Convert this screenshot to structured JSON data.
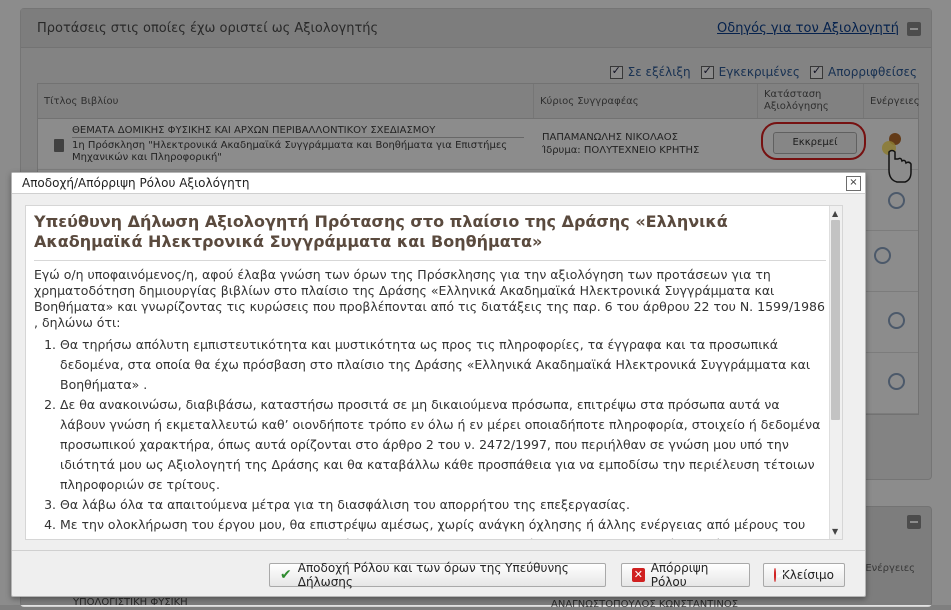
{
  "background": {
    "panel_title": "Προτάσεις στις οποίες έχω οριστεί ως Αξιολογητής",
    "guide_link": "Οδηγός για τον Αξιολογητή",
    "filters": [
      "Σε εξέλιξη",
      "Εγκεκριμένες",
      "Απορριφθείσες"
    ],
    "columns": {
      "title": "Τίτλος Βιβλίου",
      "author": "Κύριος Συγγραφέας",
      "status": "Κατάσταση Αξιολόγησης",
      "actions": "Ενέργειες"
    },
    "row": {
      "book_title": "ΘΕΜΑΤΑ ΔΟΜΙΚΗΣ ΦΥΣΙΚΗΣ ΚΑΙ ΑΡΧΩΝ ΠΕΡΙΒΑΛΛΟΝΤΙΚΟΥ ΣΧΕΔΙΑΣΜΟΥ",
      "call": "1η Πρόσκληση \"Ηλεκτρονικά Ακαδημαϊκά Συγγράμματα και Βοηθήματα για Επιστήμες Μηχανικών και Πληροφορική\"",
      "author": "ΠΑΠΑΜΑΝΩΛΗΣ ΝΙΚΟΛΑΟΣ",
      "institution": "Ίδρυμα: ΠΟΛΥΤΕΧΝΕΙΟ ΚΡΗΤΗΣ",
      "status": "Εκκρεμεί"
    },
    "panel2": {
      "col_actions": "Ενέργειες",
      "row_title": "ΥΠΟΛΟΓΙΣΤΙΚΗ ΦΥΣΙΚΗ",
      "row_author": "ΑΝΑΓΝΩΣΤΟΠΟΥΛΟΣ ΚΩΝΣΤΑΝΤΙΝΟΣ"
    }
  },
  "dialog": {
    "title": "Αποδοχή/Απόρριψη Ρόλου Αξιολόγητη",
    "close_symbol": "×",
    "heading": "Υπεύθυνη Δήλωση Αξιολογητή Πρότασης στο πλαίσιο της Δράσης «Ελληνικά Ακαδημαϊκά Ηλεκτρονικά Συγγράμματα και Βοηθήματα»",
    "intro": "Εγώ ο/η υποφαινόμενος/η, αφού έλαβα γνώση των όρων της Πρόσκλησης για την αξιολόγηση των προτάσεων για τη χρηματοδότηση δημιουργίας βιβλίων στο πλαίσιο της Δράσης «Ελληνικά Ακαδημαϊκά Ηλεκτρονικά Συγγράμματα και Βοηθήματα» και γνωρίζοντας τις κυρώσεις που προβλέπονται από τις διατάξεις της παρ. 6 του άρθρου 22 του Ν. 1599/1986 , δηλώνω ότι:",
    "items": [
      "Θα τηρήσω απόλυτη εμπιστευτικότητα και μυστικότητα ως προς τις πληροφορίες, τα έγγραφα και τα προσωπικά δεδομένα, στα οποία θα έχω πρόσβαση στο πλαίσιο της Δράσης «Ελληνικά Ακαδημαϊκά Ηλεκτρονικά Συγγράμματα και Βοηθήματα» .",
      "Δε θα ανακοινώσω, διαβιβάσω, καταστήσω προσιτά σε μη δικαιούμενα πρόσωπα, επιτρέψω στα πρόσωπα αυτά να λάβουν γνώση ή εκμεταλλευτώ καθ’ οιονδήποτε τρόπο εν όλω ή εν μέρει οποιαδήποτε πληροφορία, στοιχείο ή δεδομένα προσωπικού χαρακτήρα, όπως αυτά ορίζονται στο άρθρο 2 του ν. 2472/1997, που περιήλθαν σε γνώση μου υπό την ιδιότητά μου ως Αξιολογητή της Δράσης και θα καταβάλλω κάθε προσπάθεια για να εμποδίσω την περιέλευση τέτοιων πληροφοριών σε τρίτους.",
      "Θα λάβω όλα τα απαιτούμενα μέτρα για τη διασφάλιση του απορρήτου της επεξεργασίας.",
      "Με την ολοκλήρωση του έργου μου, θα επιστρέψω αμέσως, χωρίς ανάγκη όχλησης ή άλλης ενέργειας από μέρους του Ε.Λ.Κ.Ε. Ε.Μ.Π., οποιαδήποτε αλληλογραφία, έγγραφα, υπομνήματα, σημειώσεις, αρχεία, αναφορές, φακέλους,"
    ],
    "buttons": {
      "accept": "Αποδοχή Ρόλου και των όρων της Υπεύθυνης Δήλωσης",
      "reject": "Απόρριψη Ρόλου",
      "close": "Κλείσιμο"
    }
  },
  "colors": {
    "heading": "#5a4a3e",
    "link": "#0c3f8c",
    "highlight_ring": "#d81f1f",
    "accept_icon": "#2e8b2e",
    "reject_icon": "#d02020"
  }
}
